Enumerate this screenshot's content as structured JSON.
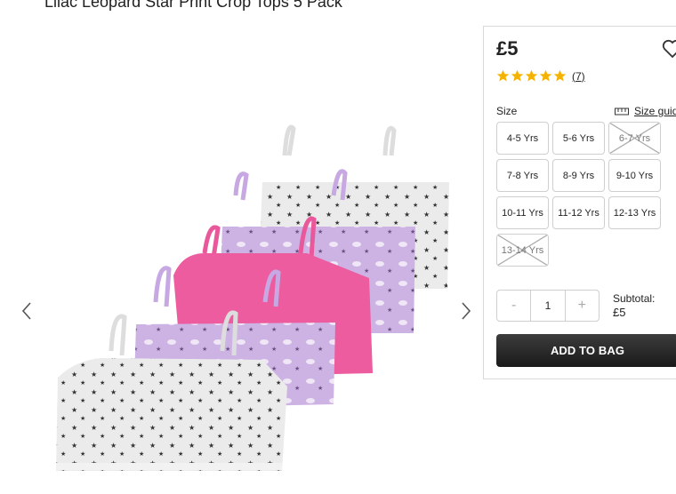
{
  "product": {
    "title": "Lilac Leopard Star Print Crop Tops 5 Pack",
    "image_alt_icon": "product-photo"
  },
  "gallery": {
    "prev_icon": "chevron-left-icon",
    "next_icon": "chevron-right-icon"
  },
  "buy_box": {
    "price": "£5",
    "wishlist_icon": "heart-icon",
    "rating_stars": 5,
    "review_count": "(7)",
    "size_label": "Size",
    "size_guide_label": "Size guide",
    "sizes": [
      {
        "label": "4-5 Yrs",
        "available": true
      },
      {
        "label": "5-6 Yrs",
        "available": true
      },
      {
        "label": "6-7 Yrs",
        "available": false
      },
      {
        "label": "7-8 Yrs",
        "available": true
      },
      {
        "label": "8-9 Yrs",
        "available": true
      },
      {
        "label": "9-10 Yrs",
        "available": true
      },
      {
        "label": "10-11 Yrs",
        "available": true
      },
      {
        "label": "11-12 Yrs",
        "available": true
      },
      {
        "label": "12-13 Yrs",
        "available": true
      },
      {
        "label": "13-14 Yrs",
        "available": false
      }
    ],
    "quantity": {
      "minus": "-",
      "value": "1",
      "plus": "+"
    },
    "subtotal_label": "Subtotal:",
    "subtotal_value": "£5",
    "add_to_bag_label": "ADD TO BAG"
  },
  "colors": {
    "star": "#f5b301",
    "button_dark": "#222222",
    "pink": "#e8589a",
    "lilac": "#c9aee0"
  }
}
